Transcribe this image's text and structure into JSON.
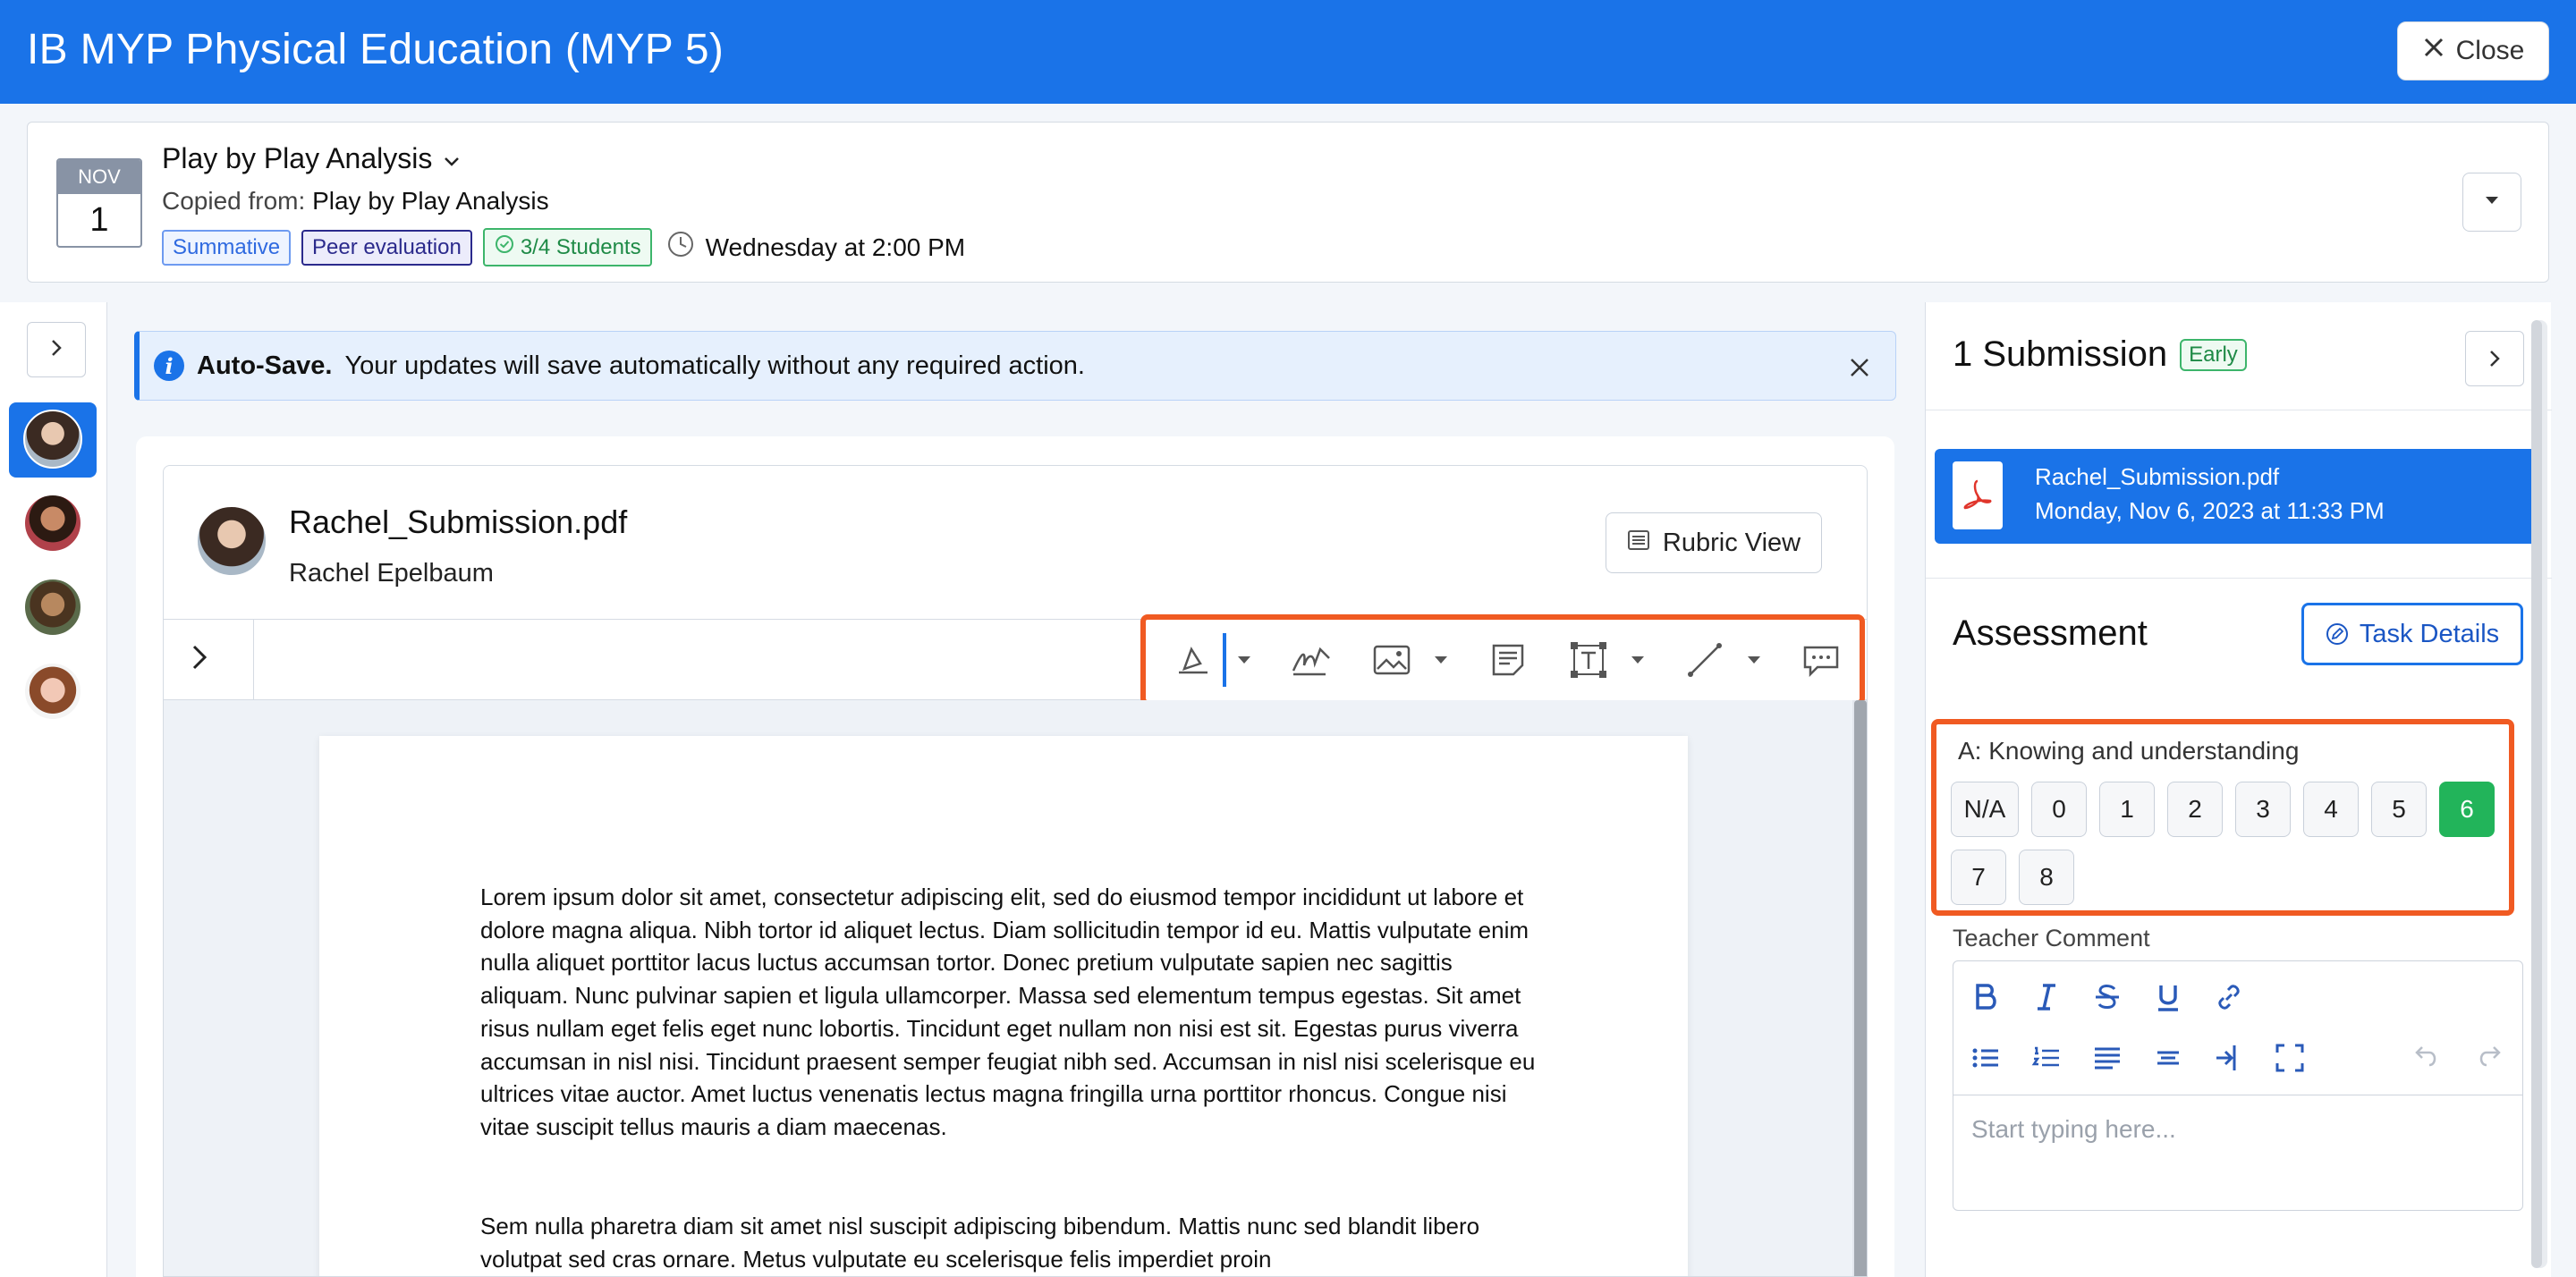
{
  "window": {
    "title": "IB MYP Physical Education (MYP 5)",
    "close_label": "Close"
  },
  "task": {
    "month": "NOV",
    "day": "1",
    "title": "Play by Play Analysis",
    "copied_prefix": "Copied from:",
    "copied_source": "Play by Play Analysis",
    "tags": {
      "summative": "Summative",
      "peer": "Peer evaluation",
      "students": "3/4 Students"
    },
    "due": "Wednesday at 2:00 PM"
  },
  "notice": {
    "title": "Auto-Save.",
    "text": "Your updates will save automatically without any required action."
  },
  "document": {
    "file_name": "Rachel_Submission.pdf",
    "author": "Rachel Epelbaum",
    "rubric_label": "Rubric View",
    "paragraph1": "Lorem ipsum dolor sit amet, consectetur adipiscing elit, sed do eiusmod tempor incididunt ut labore et dolore magna aliqua. Nibh tortor id aliquet lectus. Diam sollicitudin tempor id eu. Mattis vulputate enim nulla aliquet porttitor lacus luctus accumsan tortor. Donec pretium vulputate sapien nec sagittis aliquam. Nunc pulvinar sapien et ligula ullamcorper. Massa sed elementum tempus egestas. Sit amet risus nullam eget felis eget nunc lobortis. Tincidunt eget nullam non nisi est sit. Egestas purus viverra accumsan in nisl nisi. Tincidunt praesent semper feugiat nibh sed. Accumsan in nisl nisi scelerisque eu ultrices vitae auctor. Amet luctus venenatis lectus magna fringilla urna porttitor rhoncus. Congue nisi vitae suscipit tellus mauris a diam maecenas.",
    "paragraph2": "Sem nulla pharetra diam sit amet nisl suscipit adipiscing bibendum. Mattis nunc sed blandit libero volutpat sed cras ornare. Metus vulputate eu scelerisque felis imperdiet proin"
  },
  "submission": {
    "title": "1 Submission",
    "badge": "Early",
    "file_name": "Rachel_Submission.pdf",
    "file_date": "Monday, Nov 6, 2023 at 11:33 PM"
  },
  "assessment": {
    "title": "Assessment",
    "task_details_label": "Task Details",
    "criterion_label": "A: Knowing and understanding",
    "levels": [
      "N/A",
      "0",
      "1",
      "2",
      "3",
      "4",
      "5",
      "6",
      "7",
      "8"
    ],
    "selected_level": "6",
    "comment_label": "Teacher Comment",
    "comment_placeholder": "Start typing here..."
  },
  "colors": {
    "brand": "#1a73e8",
    "highlight": "#f05a22",
    "selected": "#22b45a"
  }
}
